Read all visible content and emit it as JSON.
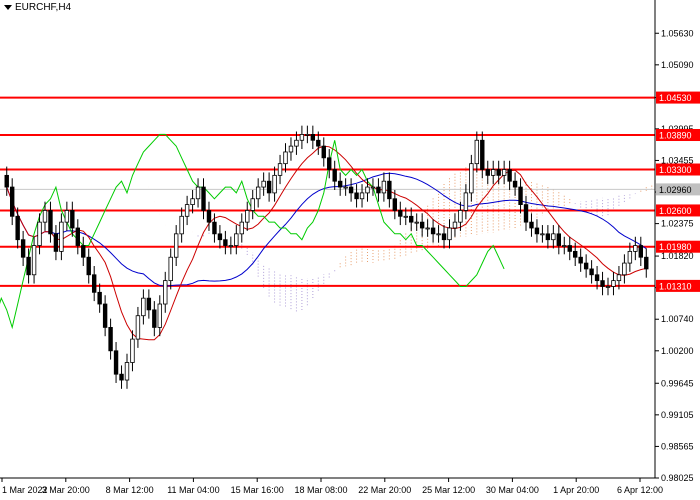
{
  "window": {
    "symbol": "EURCHF,H4"
  },
  "colors": {
    "candle": "#000000",
    "level": "#ff0000",
    "kijun": "#0000cc",
    "tenkan": "#cc0000",
    "chikou": "#00cc00",
    "kumo_bull": "#e8a070",
    "kumo_bear": "#b0a0d8",
    "bid_line": "#c8c8c8",
    "axis_text": "#000000"
  },
  "chart_data": {
    "type": "candlestick",
    "symbol": "EURCHF",
    "timeframe": "H4",
    "ylim": [
      0.98025,
      1.05925
    ],
    "price_axis": [
      "1.05630",
      "1.05090",
      "1.04530",
      "1.03995",
      "1.03455",
      "1.02915",
      "1.02375",
      "1.01820",
      "1.01280",
      "1.00740",
      "1.00200",
      "0.99645",
      "0.99105",
      "0.98565",
      "0.98025"
    ],
    "time_axis": [
      "1 Mar 2022",
      "3 Mar 20:00",
      "8 Mar 12:00",
      "11 Mar 04:00",
      "15 Mar 16:00",
      "18 Mar 08:00",
      "22 Mar 20:00",
      "25 Mar 12:00",
      "30 Mar 04:00",
      "1 Apr 20:00",
      "6 Apr 12:00"
    ],
    "levels": [
      "1.04530",
      "1.03890",
      "1.03300",
      "1.02600",
      "1.01980",
      "1.01310"
    ],
    "current_price": "1.02960",
    "close": [
      1.03,
      1.025,
      1.021,
      1.018,
      1.015,
      1.02,
      1.024,
      1.026,
      1.022,
      1.019,
      1.024,
      1.026,
      1.023,
      1.02,
      1.018,
      1.015,
      1.012,
      1.01,
      1.006,
      1.002,
      0.998,
      0.997,
      1.0,
      1.004,
      1.008,
      1.011,
      1.009,
      1.006,
      1.01,
      1.014,
      1.018,
      1.022,
      1.025,
      1.027,
      1.028,
      1.03,
      1.026,
      1.024,
      1.022,
      1.021,
      1.02,
      1.02,
      1.022,
      1.024,
      1.026,
      1.028,
      1.03,
      1.031,
      1.029,
      1.032,
      1.034,
      1.036,
      1.037,
      1.038,
      1.039,
      1.039,
      1.038,
      1.037,
      1.035,
      1.033,
      1.031,
      1.03,
      1.03,
      1.029,
      1.028,
      1.029,
      1.03,
      1.03,
      1.029,
      1.031,
      1.028,
      1.026,
      1.025,
      1.025,
      1.024,
      1.024,
      1.023,
      1.023,
      1.022,
      1.022,
      1.021,
      1.023,
      1.024,
      1.026,
      1.029,
      1.034,
      1.038,
      1.033,
      1.032,
      1.033,
      1.032,
      1.033,
      1.031,
      1.03,
      1.027,
      1.024,
      1.023,
      1.022,
      1.022,
      1.021,
      1.022,
      1.02,
      1.02,
      1.019,
      1.018,
      1.017,
      1.016,
      1.015,
      1.014,
      1.013,
      1.013,
      1.014,
      1.015,
      1.017,
      1.019,
      1.02,
      1.018,
      1.016
    ]
  }
}
